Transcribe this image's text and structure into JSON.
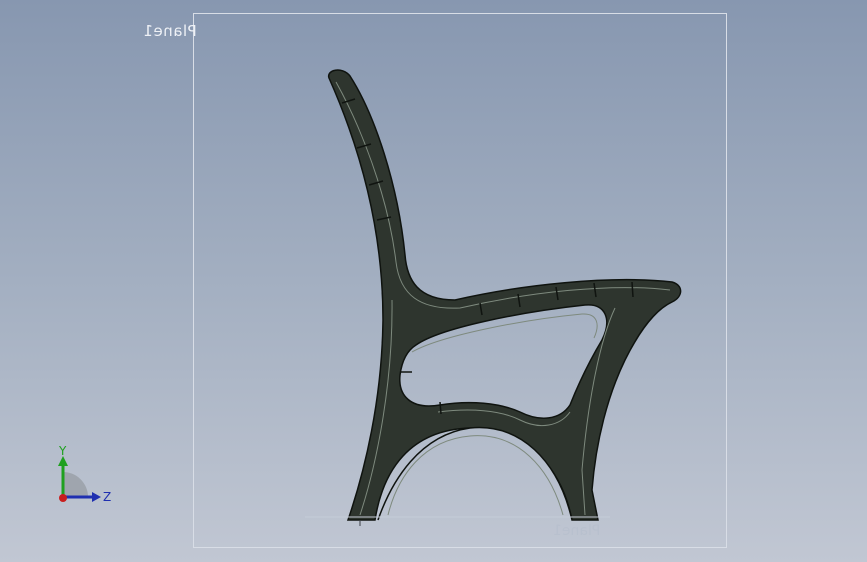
{
  "viewport": {
    "plane_label": "Plane1",
    "plane_label_bottom": "Plane1"
  },
  "triad": {
    "y_axis": "Y",
    "z_axis": "Z",
    "colors": {
      "y": "#1fa01f",
      "z": "#1f2fb0",
      "x": "#c81e1e"
    }
  },
  "model": {
    "name": "bench-side-frame",
    "fill_color": "#2e352e",
    "edge_color": "#0f130f"
  }
}
